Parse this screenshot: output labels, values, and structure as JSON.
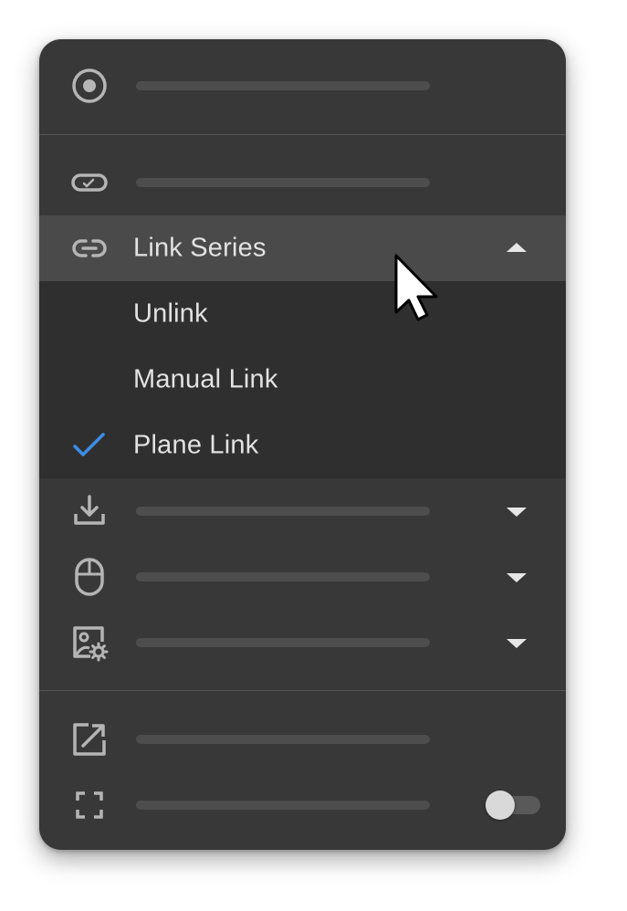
{
  "menu": {
    "items": [
      {
        "icon": "target-icon",
        "label": ""
      },
      {
        "icon": "ticket-icon",
        "label": ""
      },
      {
        "icon": "link-icon",
        "label": "Link Series",
        "expanded": true
      },
      {
        "icon": "download-icon",
        "label": ""
      },
      {
        "icon": "mouse-icon",
        "label": ""
      },
      {
        "icon": "image-settings-icon",
        "label": ""
      },
      {
        "icon": "external-link-icon",
        "label": ""
      },
      {
        "icon": "fullscreen-icon",
        "label": "",
        "toggle": false
      }
    ],
    "link_series": {
      "label": "Link Series",
      "options": [
        {
          "label": "Unlink",
          "checked": false
        },
        {
          "label": "Manual Link",
          "checked": false
        },
        {
          "label": "Plane Link",
          "checked": true
        }
      ]
    }
  },
  "colors": {
    "menu_bg": "#383838",
    "active_row": "#4a4a4a",
    "submenu_bg": "#2f2f2f",
    "check": "#3b8ee6",
    "icon": "#b5b5b5",
    "text": "#e2e2e2"
  }
}
